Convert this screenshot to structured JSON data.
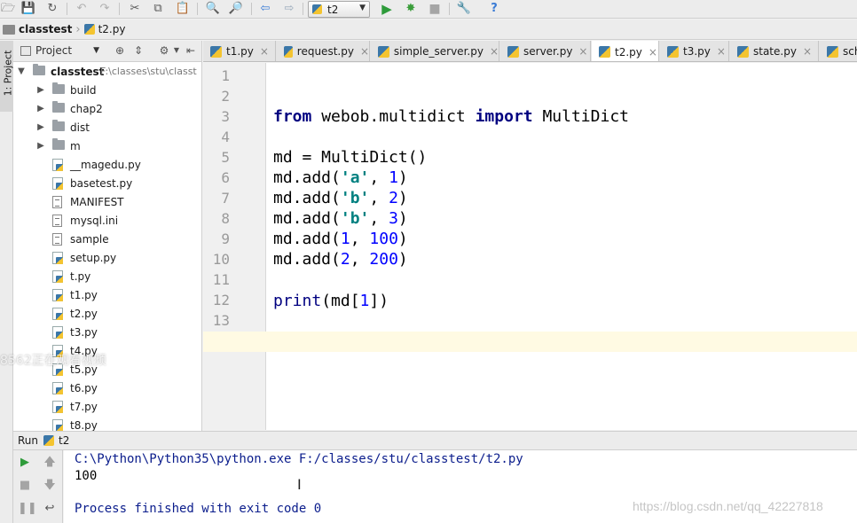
{
  "toolbar": {
    "run_config": "t2",
    "icons": [
      "open-icon",
      "save-icon",
      "sync-icon",
      "undo-icon",
      "redo-icon",
      "cut-icon",
      "copy-icon",
      "paste-icon",
      "find-icon",
      "replace-icon",
      "back-icon",
      "forward-icon",
      "run-icon",
      "debug-icon",
      "stop-icon",
      "settings-icon",
      "help-icon"
    ]
  },
  "breadcrumb": {
    "project": "classtest",
    "file": "t2.py"
  },
  "left_strip": {
    "project_tab": "1: Project"
  },
  "project_panel": {
    "view": "Project",
    "root": {
      "name": "classtest",
      "path": "F:\\classes\\stu\\classt"
    },
    "folders": [
      "build",
      "chap2",
      "dist",
      "m"
    ],
    "files": [
      {
        "name": "__magedu.py",
        "type": "py"
      },
      {
        "name": "basetest.py",
        "type": "py"
      },
      {
        "name": "MANIFEST",
        "type": "txt"
      },
      {
        "name": "mysql.ini",
        "type": "txt"
      },
      {
        "name": "sample",
        "type": "txt"
      },
      {
        "name": "setup.py",
        "type": "py"
      },
      {
        "name": "t.py",
        "type": "py"
      },
      {
        "name": "t1.py",
        "type": "py"
      },
      {
        "name": "t2.py",
        "type": "py"
      },
      {
        "name": "t3.py",
        "type": "py"
      },
      {
        "name": "t4.py",
        "type": "py"
      },
      {
        "name": "t5.py",
        "type": "py"
      },
      {
        "name": "t6.py",
        "type": "py"
      },
      {
        "name": "t7.py",
        "type": "py"
      },
      {
        "name": "t8.py",
        "type": "py"
      }
    ]
  },
  "editor_tabs": [
    "t1.py",
    "request.py",
    "simple_server.py",
    "server.py",
    "t2.py",
    "t3.py",
    "state.py",
    "sche"
  ],
  "active_tab": "t2.py",
  "editor": {
    "line_numbers": [
      "1",
      "2",
      "3",
      "4",
      "5",
      "6",
      "7",
      "8",
      "9",
      "10",
      "11",
      "12",
      "13"
    ],
    "code": {
      "l2_from": "from",
      "l2_mod": " webob.multidict ",
      "l2_import": "import",
      "l2_name": " MultiDict",
      "l4": "md = MultiDict()",
      "l5_a": "md.add(",
      "l5_s": "'a'",
      "l5_c": ", ",
      "l5_n": "1",
      "l5_e": ")",
      "l6_s": "'b'",
      "l6_n": "2",
      "l7_s": "'b'",
      "l7_n": "3",
      "l8_a": "md.add(",
      "l8_n1": "1",
      "l8_n2": "100",
      "l9_n1": "2",
      "l9_n2": "200",
      "l11_print": "print",
      "l11_a": "(md[",
      "l11_n": "1",
      "l11_e": "])"
    }
  },
  "run_panel": {
    "label": "Run",
    "config": "t2",
    "command": "C:\\Python\\Python35\\python.exe F:/classes/stu/classtest/t2.py",
    "output": "100",
    "exit_message": "Process finished with exit code 0"
  },
  "overlays": {
    "watermark_top": "8562正在观看视频",
    "watermark_csdn": "https://blog.csdn.net/qq_42227818"
  }
}
